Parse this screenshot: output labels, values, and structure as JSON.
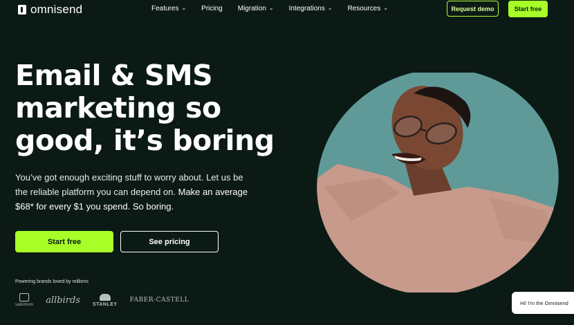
{
  "brand": {
    "name": "omnisend"
  },
  "nav": {
    "items": [
      {
        "label": "Features",
        "has_dropdown": true
      },
      {
        "label": "Pricing",
        "has_dropdown": false
      },
      {
        "label": "Migration",
        "has_dropdown": true
      },
      {
        "label": "Integrations",
        "has_dropdown": true
      },
      {
        "label": "Resources",
        "has_dropdown": true
      }
    ],
    "request_demo": "Request demo",
    "start_free": "Start free"
  },
  "hero": {
    "headline_line1": "Email & SMS",
    "headline_line2": "marketing so",
    "headline_line3": "good, it’s boring",
    "subtext_part1": "You’ve got enough exciting stuff to worry about. Let us be the reliable platform you can depend on.",
    "subtext_part2": "Make an average $68* for every $1 you spend. So boring.",
    "cta_primary": "Start free",
    "cta_secondary": "See pricing",
    "powered_by": "Powering brands loved by millions"
  },
  "brands": {
    "salomon": "salomon",
    "allbirds": "allbirds",
    "stanley": "STANLEY",
    "faber_castell": "FABER-CASTELL"
  },
  "chat": {
    "text": "Hi! I'm the Omnisend"
  },
  "colors": {
    "background": "#0c1a16",
    "accent": "#a8ff27",
    "hero_circle": "#5f9a98",
    "sweater": "#c99a8a"
  },
  "icons": {
    "logo": "omnisend-logo-icon",
    "dropdown": "chevron-down-icon"
  }
}
